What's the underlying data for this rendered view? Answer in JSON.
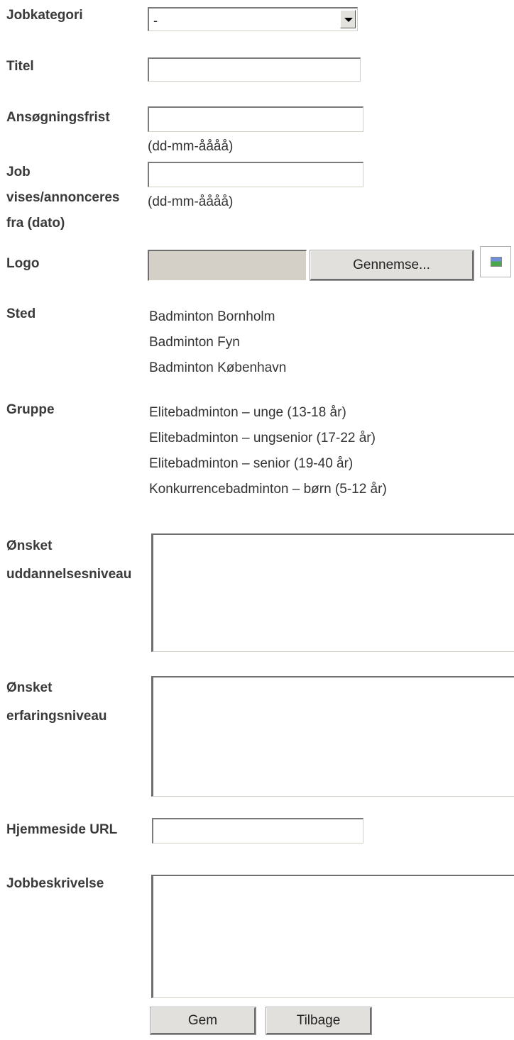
{
  "form": {
    "jobkategori": {
      "label": "Jobkategori",
      "selected": "-"
    },
    "titel": {
      "label": "Titel",
      "value": ""
    },
    "ansoegningsfrist": {
      "label": "Ansøgningsfrist",
      "value": "",
      "hint": "(dd-mm-åååå)"
    },
    "vises_fra": {
      "label_lines": [
        "Job",
        "vises/annonceres",
        "fra (dato)"
      ],
      "value": "",
      "hint": "(dd-mm-åååå)"
    },
    "logo": {
      "label": "Logo",
      "browse_label": "Gennemse...",
      "icon": "image-placeholder-icon"
    },
    "sted": {
      "label": "Sted",
      "options": [
        "Badminton Bornholm",
        "Badminton Fyn",
        "Badminton København"
      ]
    },
    "gruppe": {
      "label": "Gruppe",
      "options": [
        "Elitebadminton – unge (13-18 år)",
        "Elitebadminton – ungsenior (17-22 år)",
        "Elitebadminton – senior (19-40 år)",
        "Konkurrencebadminton – børn (5-12 år)"
      ]
    },
    "uddannelsesniveau": {
      "label_lines": [
        "Ønsket",
        "uddannelsesniveau"
      ],
      "value": ""
    },
    "erfaringsniveau": {
      "label_lines": [
        "Ønsket",
        "erfaringsniveau"
      ],
      "value": ""
    },
    "hjemmeside": {
      "label": "Hjemmeside URL",
      "value": ""
    },
    "jobbeskrivelse": {
      "label": "Jobbeskrivelse",
      "value": ""
    }
  },
  "actions": {
    "save_label": "Gem",
    "back_label": "Tilbage"
  }
}
